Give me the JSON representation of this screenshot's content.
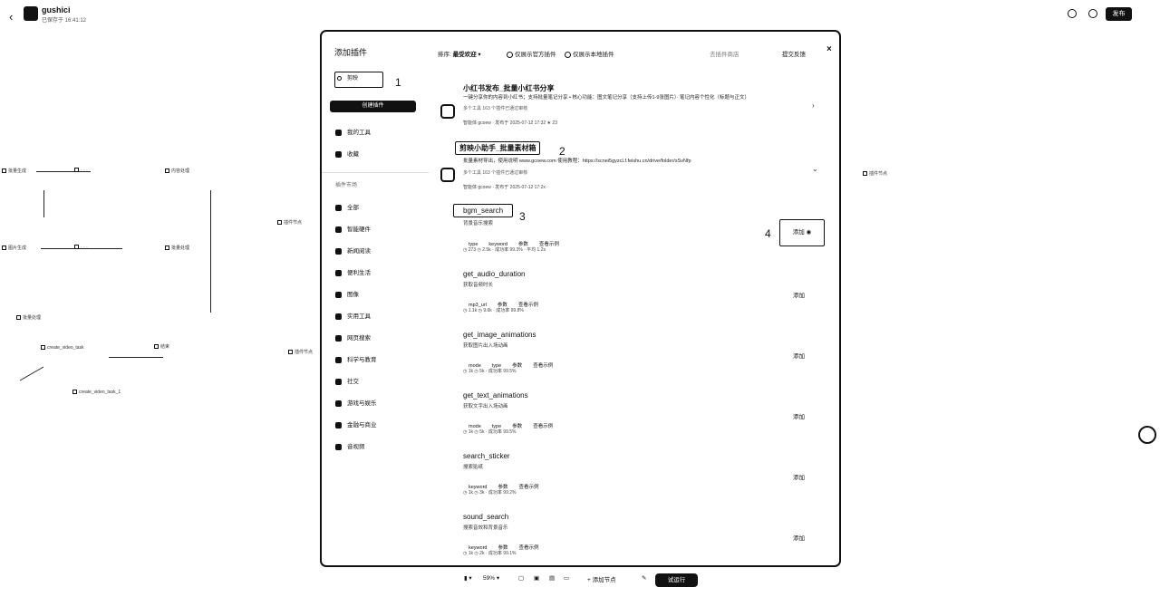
{
  "topbar": {
    "back": "‹",
    "app_name": "gushici",
    "app_sub": "已保存于 16:41:12",
    "publish": "发布"
  },
  "dialog": {
    "title": "添加插件",
    "search_value": "剪映",
    "create_plugin": "创建插件",
    "sidebar": {
      "my_tools": "我的工具",
      "favorites": "收藏",
      "category_title": "插件市场",
      "categories": [
        "全部",
        "智能硬件",
        "新闻阅读",
        "便利生活",
        "图像",
        "实用工具",
        "网页搜索",
        "科学与教育",
        "社交",
        "游戏与娱乐",
        "金融与商业",
        "音视频"
      ]
    },
    "sort_label": "排序:",
    "sort_value": "最受欢迎",
    "filter_official": "仅展示官方插件",
    "filter_local": "仅展示本地插件",
    "link_store": "去插件商店",
    "link_feedback": "提交反馈",
    "close": "×",
    "annotations": [
      "1",
      "2",
      "3",
      "4"
    ],
    "plugins": [
      {
        "name": "小红书发布_批量小红书分享",
        "desc": "一键分享你的内容到小红书；支持批量笔记分享 • 核心功能：图文笔记分享（支持上传1-9张图片）· 笔记内容个性化（标题与正文）",
        "meta": "多个工具   163 个插件已通过审核",
        "stats": "智能体 gcoew   · 发布于 2025-07-12 17:32   ★ 23"
      },
      {
        "name": "剪映小助手_批量素材箱",
        "desc": "批量素材导出，使用说明 www.gcoew.com 使用教程：https://scnei5gyzcLf.feishu.cn/drive/folder/sSvNfp",
        "meta": "多个工具   163 个插件已通过审核",
        "stats": "智能体 gcoew   · 发布于 2025-07-12 17:2x"
      }
    ],
    "tools": [
      {
        "name": "bgm_search",
        "desc": "背景音乐搜索",
        "tags": [
          "type",
          "keyword",
          "参数",
          "查看示例"
        ],
        "stats": "◷ 273   ◷ 2.5k   · 成功率 99.3%   · 平均 1.2s",
        "add": "添加"
      },
      {
        "name": "get_audio_duration",
        "desc": "获取音频时长",
        "tags": [
          "mp3_url",
          "参数",
          "查看示例"
        ],
        "stats": "◷ 1.1k   ◷ 9.6k   · 成功率 99.8%",
        "add": "添加"
      },
      {
        "name": "get_image_animations",
        "desc": "获取图片出入场动画",
        "tags": [
          "mode",
          "type",
          "参数",
          "查看示例"
        ],
        "stats": "◷ 1k   ◷ 5k   · 成功率 99.5%",
        "add": "添加"
      },
      {
        "name": "get_text_animations",
        "desc": "获取文字出入场动画",
        "tags": [
          "mode",
          "type",
          "参数",
          "查看示例"
        ],
        "stats": "◷ 1k   ◷ 5k   · 成功率 99.5%",
        "add": "添加"
      },
      {
        "name": "search_sticker",
        "desc": "搜索贴纸",
        "tags": [
          "keyword",
          "参数",
          "查看示例"
        ],
        "stats": "◷ 1k   ◷ 3k   · 成功率 99.2%",
        "add": "添加"
      },
      {
        "name": "sound_search",
        "desc": "搜索音效和背景音乐",
        "tags": [
          "keyword",
          "参数",
          "查看示例"
        ],
        "stats": "◷ 1k   ◷ 2k   · 成功率 99.1%",
        "add": "添加"
      }
    ]
  },
  "bottombar": {
    "zoom": "59%",
    "add_node": "添加节点",
    "trial_run": "试运行"
  },
  "canvas_nodes": [
    "批量生成",
    "内容处理",
    "图片生成",
    "批量处理",
    "批量处理",
    "插件节点",
    "create_video_task",
    "结束",
    "插件节点",
    "create_video_task_1",
    "插件节点"
  ]
}
